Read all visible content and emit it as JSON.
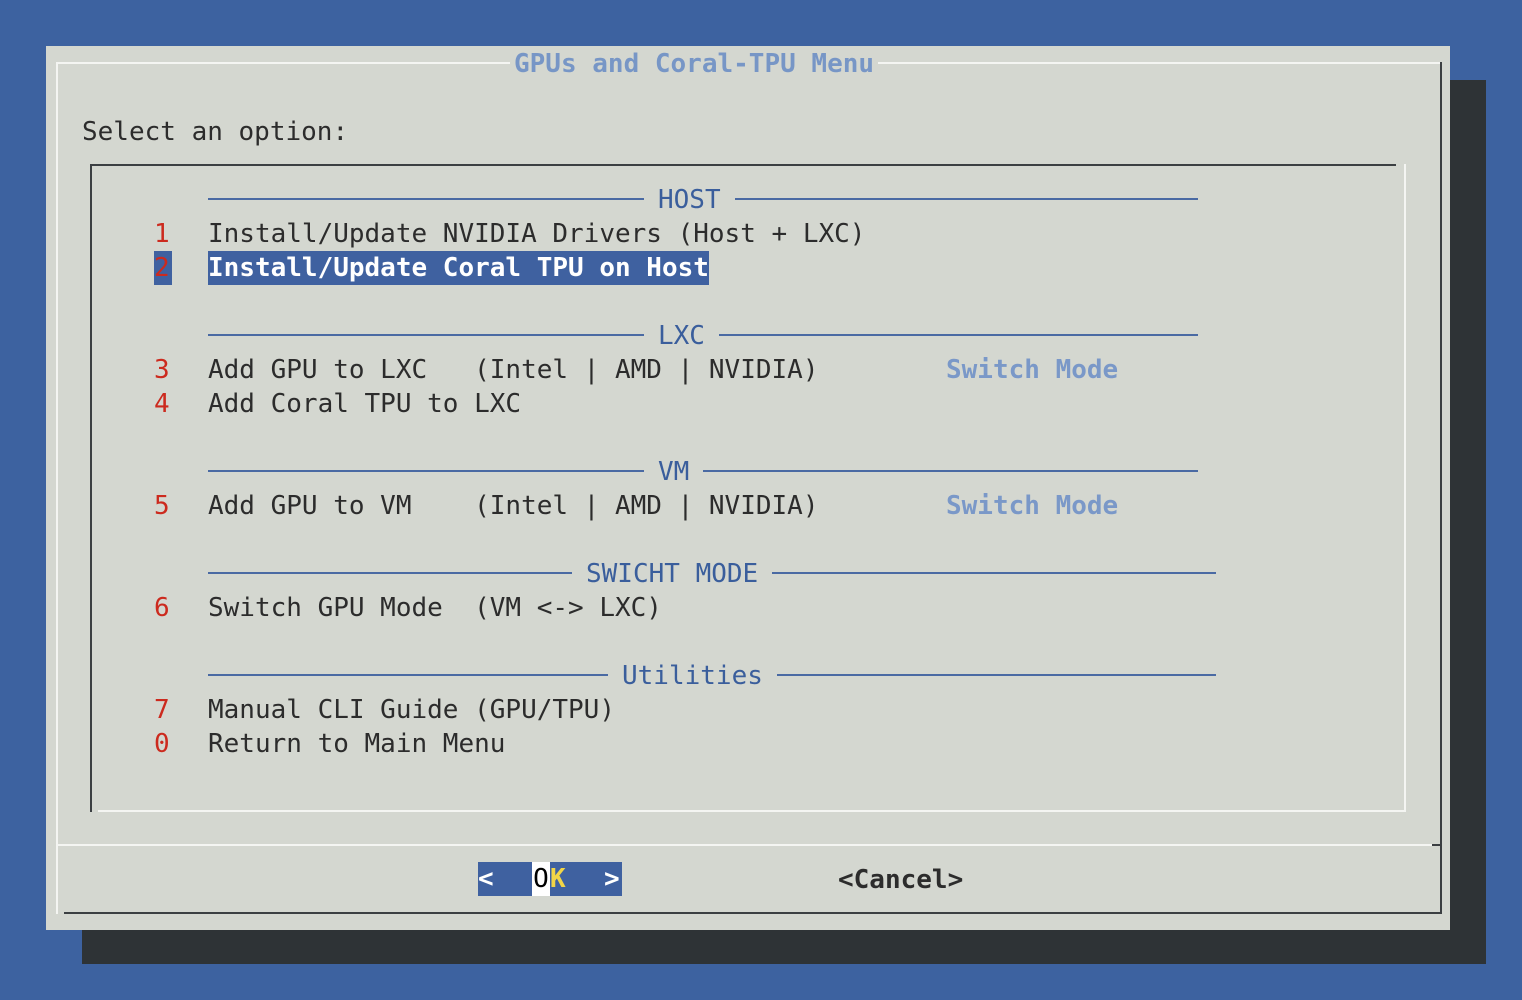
{
  "dialog": {
    "title": "GPUs and Coral-TPU Menu",
    "prompt": "Select an option:"
  },
  "menu": {
    "sections": {
      "host": "HOST",
      "lxc": "LXC",
      "vm": "VM",
      "switch": "SWICHT MODE",
      "utilities": "Utilities"
    },
    "items": [
      {
        "key": "1",
        "label": "Install/Update NVIDIA Drivers (Host + LXC)",
        "selected": false
      },
      {
        "key": "2",
        "label": "Install/Update Coral TPU on Host",
        "selected": true
      },
      {
        "key": "3",
        "label": "Add GPU to LXC   (Intel | AMD | NVIDIA)",
        "tag": "Switch Mode"
      },
      {
        "key": "4",
        "label": "Add Coral TPU to LXC"
      },
      {
        "key": "5",
        "label": "Add GPU to VM    (Intel | AMD | NVIDIA)",
        "tag": "Switch Mode"
      },
      {
        "key": "6",
        "label": "Switch GPU Mode  (VM <-> LXC)"
      },
      {
        "key": "7",
        "label": "Manual CLI Guide (GPU/TPU)"
      },
      {
        "key": "0",
        "label": "Return to Main Menu"
      }
    ]
  },
  "buttons": {
    "ok_left": "<",
    "ok_o": "O",
    "ok_k": "K",
    "ok_right": ">",
    "cancel": "<Cancel>"
  },
  "colors": {
    "background": "#3d62a0",
    "dialog": "#d4d7d0",
    "highlight": "#3f61a0",
    "hotkey": "#cc2a1e",
    "accent": "#7796c6"
  }
}
